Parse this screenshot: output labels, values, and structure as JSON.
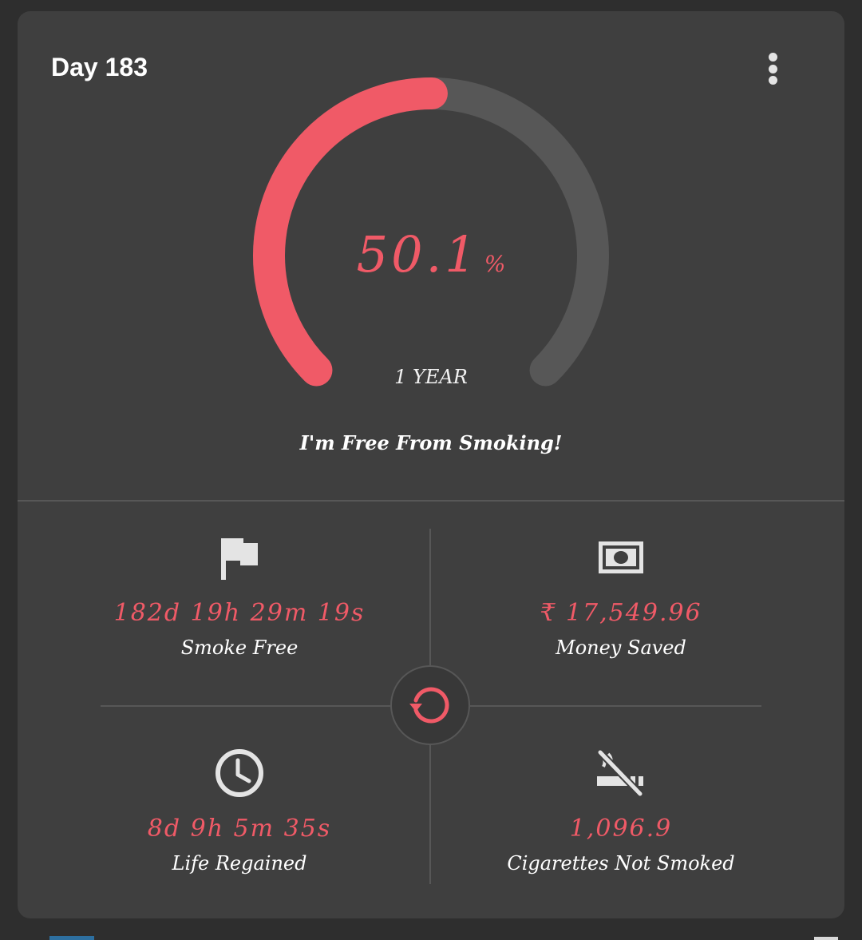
{
  "header": {
    "title": "Day 183"
  },
  "progress": {
    "fraction": 0.501,
    "percent_value": "50.1",
    "percent_unit": "%",
    "goal_label": "1 YEAR"
  },
  "tagline": "I'm Free From Smoking!",
  "stats": {
    "smoke_free": {
      "value": "182d 19h 29m 19s",
      "label": "Smoke Free",
      "icon": "flag-icon"
    },
    "money_saved": {
      "value": "₹ 17,549.96",
      "label": "Money Saved",
      "icon": "money-icon"
    },
    "life_regained": {
      "value": "8d 9h 5m 35s",
      "label": "Life Regained",
      "icon": "clock-icon"
    },
    "cigarettes_not_smoked": {
      "value": "1,096.9",
      "label": "Cigarettes Not Smoked",
      "icon": "no-smoking-icon"
    }
  },
  "colors": {
    "accent": "#f05a67",
    "track": "#575757",
    "card": "#3f3f3f",
    "background": "#2e2e2e"
  },
  "actions": {
    "reset_icon": "reset-icon",
    "menu_icon": "more-vertical-icon"
  }
}
